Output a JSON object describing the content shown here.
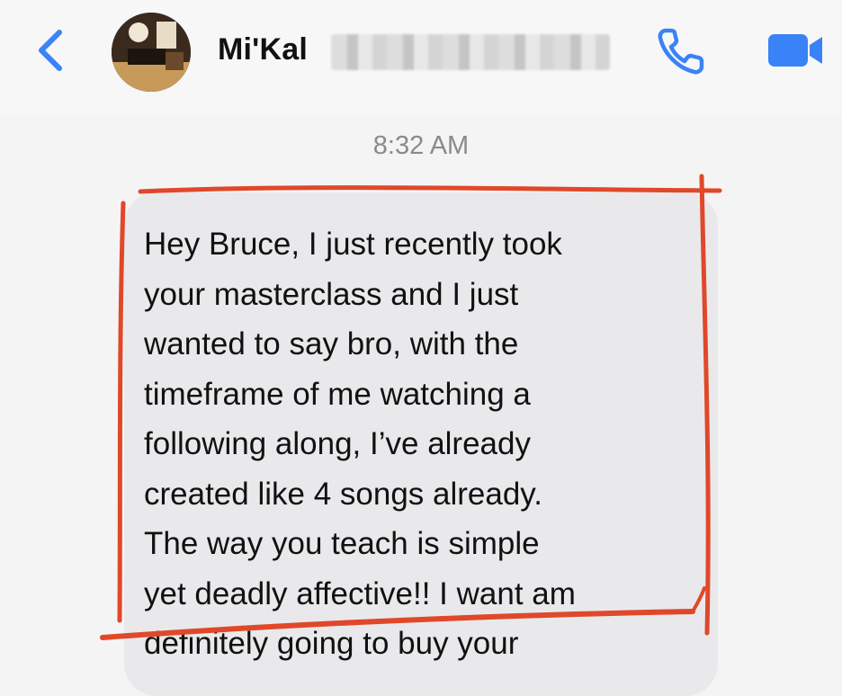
{
  "header": {
    "back_icon": "chevron-left-icon",
    "contact_name": "Mi'Kal",
    "call_icon": "phone-icon",
    "video_icon": "video-camera-icon",
    "accent_color": "#3a82f7"
  },
  "conversation": {
    "timestamp": "8:32 AM",
    "message": "Hey Bruce, I just recently took\nyour masterclass and I just\nwanted to say bro, with the\ntimeframe of me watching a\nfollowing along, I’ve already\ncreated like 4 songs already.\nThe way you teach is simple\nyet deadly affective!! I want am\ndefinitely going to buy your"
  },
  "annotation": {
    "stroke_color": "#e0482a"
  }
}
